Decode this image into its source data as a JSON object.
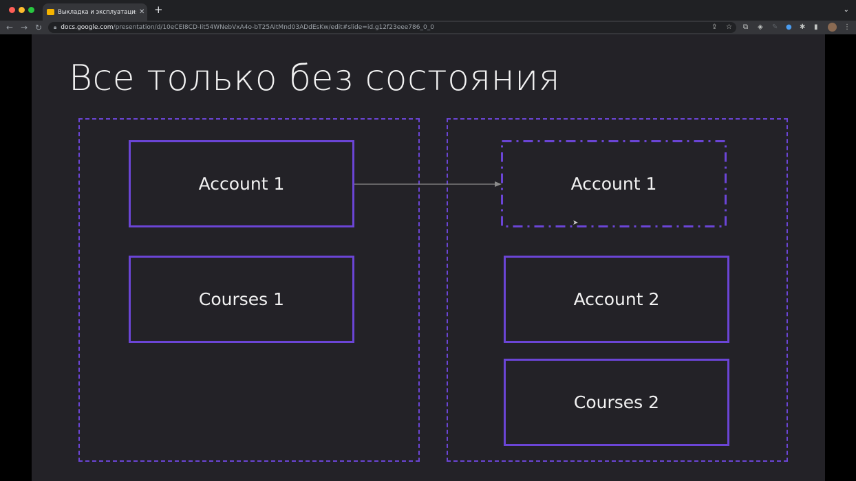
{
  "browser": {
    "tab_title": "Выкладка и эксплуатация - G",
    "url_host": "docs.google.com",
    "url_path": "/presentation/d/10eCEI8CD-Iit54WNebVxA4o-bT25AItMnd03ADdEsKw/edit#slide=id.g12f23eee786_0_0"
  },
  "slide": {
    "title": "Все только без состояния",
    "left_group": {
      "account": "Account 1",
      "courses": "Courses 1"
    },
    "right_group": {
      "account_ghost": "Account 1",
      "account": "Account 2",
      "courses": "Courses 2"
    }
  },
  "colors": {
    "accent": "#6b45d6",
    "slide_bg": "#232227",
    "text": "#f2f2f2",
    "arrow": "#8a8a8a"
  }
}
